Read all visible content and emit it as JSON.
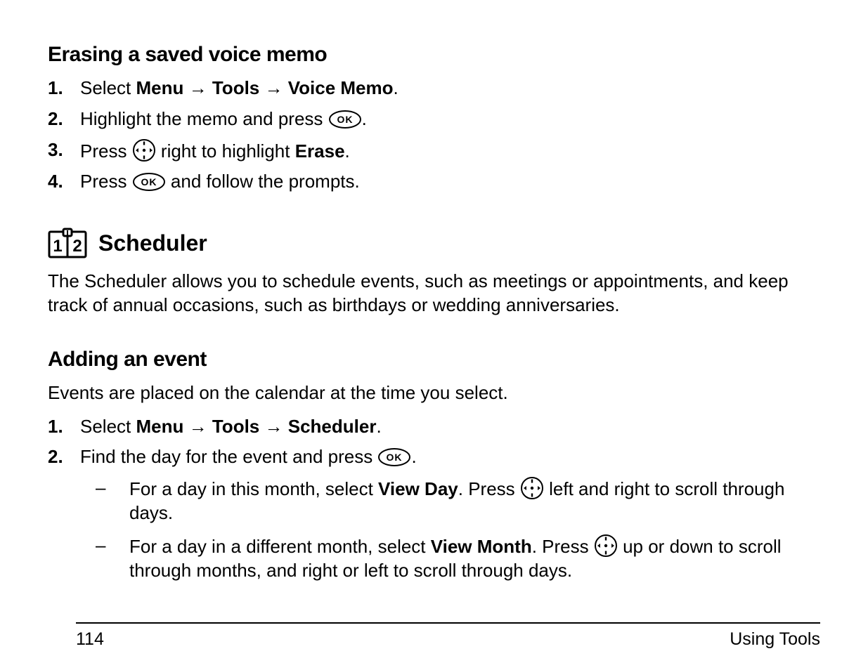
{
  "heading_erase": "Erasing a saved voice memo",
  "steps_erase": {
    "s1": {
      "num": "1.",
      "pre": "Select ",
      "menu": "Menu",
      "tools": "Tools",
      "vm": "Voice Memo",
      "post": "."
    },
    "s2": {
      "num": "2.",
      "pre": "Highlight the memo and press ",
      "post": "."
    },
    "s3": {
      "num": "3.",
      "pre": "Press ",
      "mid": " right to highlight ",
      "erase": "Erase",
      "post": "."
    },
    "s4": {
      "num": "4.",
      "pre": "Press ",
      "post": " and follow the prompts."
    }
  },
  "scheduler_title": "Scheduler",
  "scheduler_body": "The Scheduler allows you to schedule events, such as meetings or appointments, and keep track of annual occasions, such as birthdays or wedding anniversaries.",
  "adding_title": "Adding an event",
  "adding_intro": "Events are placed on the calendar at the time you select.",
  "steps_add": {
    "s1": {
      "num": "1.",
      "pre": "Select ",
      "menu": "Menu",
      "tools": "Tools",
      "sched": "Scheduler",
      "post": "."
    },
    "s2": {
      "num": "2.",
      "pre": "Find the day for the event and press ",
      "post": ".",
      "b1": {
        "pre": "For a day in this month, select ",
        "viewday": "View Day",
        "mid": ". Press ",
        "post": " left and right to scroll through days."
      },
      "b2": {
        "pre": "For a day in a different month, select ",
        "viewmonth": "View Month",
        "mid": ". Press ",
        "post": " up or down to scroll through months, and right or left to scroll through days."
      }
    }
  },
  "arrow": "→",
  "dash": "–",
  "footer": {
    "page": "114",
    "section": "Using Tools"
  }
}
